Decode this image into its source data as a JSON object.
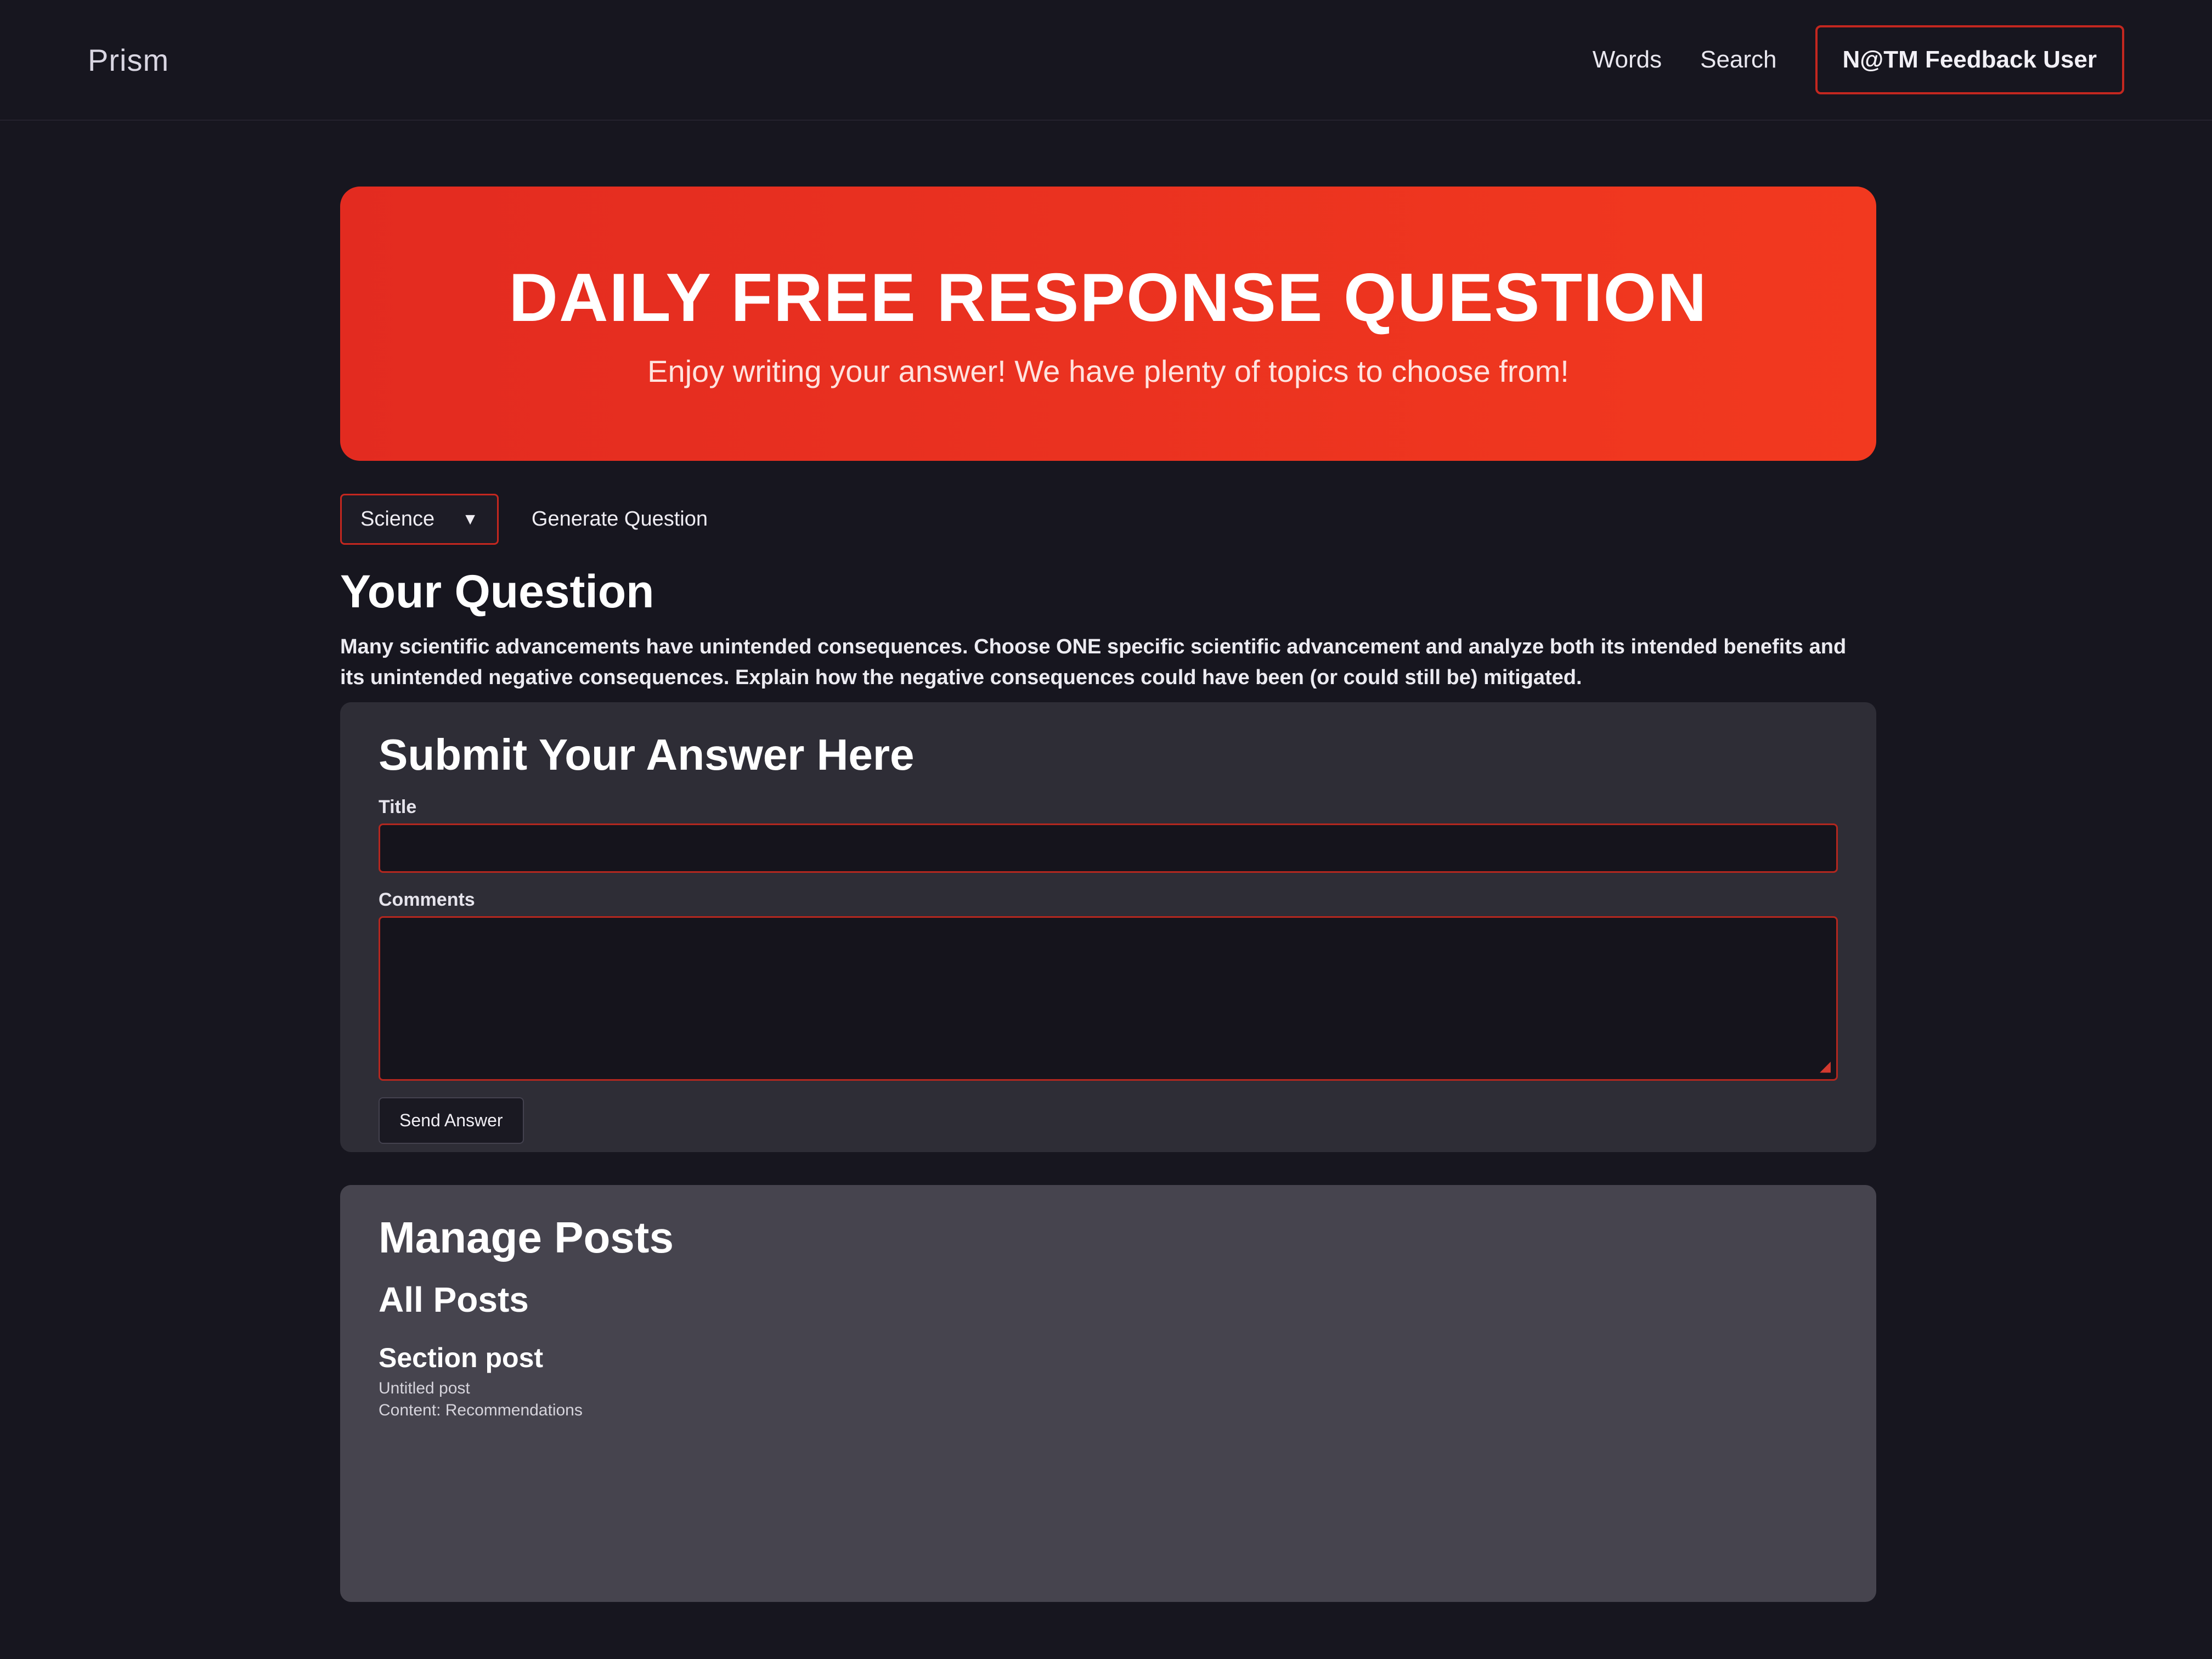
{
  "header": {
    "brand": "Prism",
    "nav": [
      "Words",
      "Search"
    ],
    "user": "N@TM Feedback User"
  },
  "hero": {
    "title": "DAILY FREE RESPONSE QUESTION",
    "subtitle": "Enjoy writing your answer! We have plenty of topics to choose from!"
  },
  "controls": {
    "topic_selected": "Science",
    "generate_label": "Generate Question"
  },
  "question": {
    "heading": "Your Question",
    "text": "Many scientific advancements have unintended consequences. Choose ONE specific scientific advancement and analyze both its intended benefits and its unintended negative consequences. Explain how the negative consequences could have been (or could still be) mitigated."
  },
  "answer": {
    "heading": "Submit Your Answer Here",
    "title_label": "Title",
    "content_label": "Comments",
    "send_label": "Send Answer"
  },
  "manage": {
    "heading": "Manage Posts",
    "all_heading": "All Posts",
    "post": {
      "title": "Section post",
      "meta": "Untitled post",
      "body": "Content: Recommendations"
    }
  }
}
